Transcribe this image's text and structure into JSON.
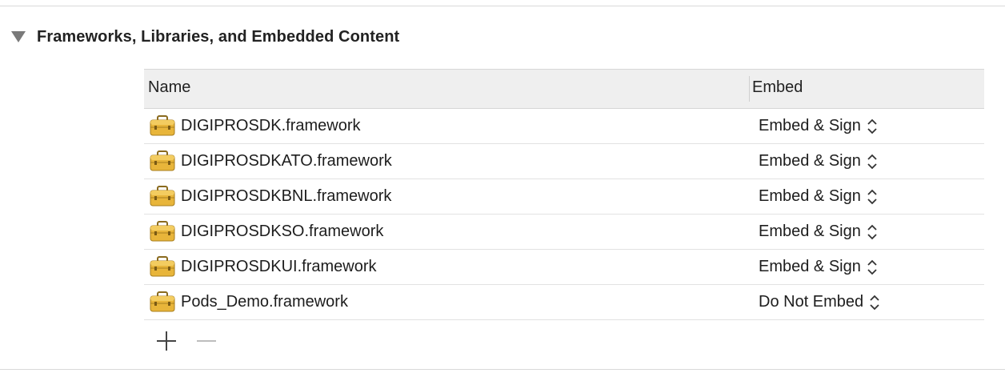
{
  "section": {
    "title": "Frameworks, Libraries, and Embedded Content",
    "disclosure_icon": "disclosure-triangle-down-icon"
  },
  "table": {
    "columns": {
      "name": "Name",
      "embed": "Embed"
    },
    "rows": [
      {
        "name": "DIGIPROSDK.framework",
        "embed": "Embed & Sign",
        "icon": "framework-toolbox-icon"
      },
      {
        "name": "DIGIPROSDKATO.framework",
        "embed": "Embed & Sign",
        "icon": "framework-toolbox-icon"
      },
      {
        "name": "DIGIPROSDKBNL.framework",
        "embed": "Embed & Sign",
        "icon": "framework-toolbox-icon"
      },
      {
        "name": "DIGIPROSDKSO.framework",
        "embed": "Embed & Sign",
        "icon": "framework-toolbox-icon"
      },
      {
        "name": "DIGIPROSDKUI.framework",
        "embed": "Embed & Sign",
        "icon": "framework-toolbox-icon"
      },
      {
        "name": "Pods_Demo.framework",
        "embed": "Do Not Embed",
        "icon": "framework-toolbox-icon"
      }
    ]
  },
  "footer": {
    "add_icon": "plus-icon",
    "remove_icon": "minus-icon"
  },
  "colors": {
    "framework_icon": "#e8b53a",
    "header_bg": "#efefef",
    "separator": "#e2e2e2"
  }
}
